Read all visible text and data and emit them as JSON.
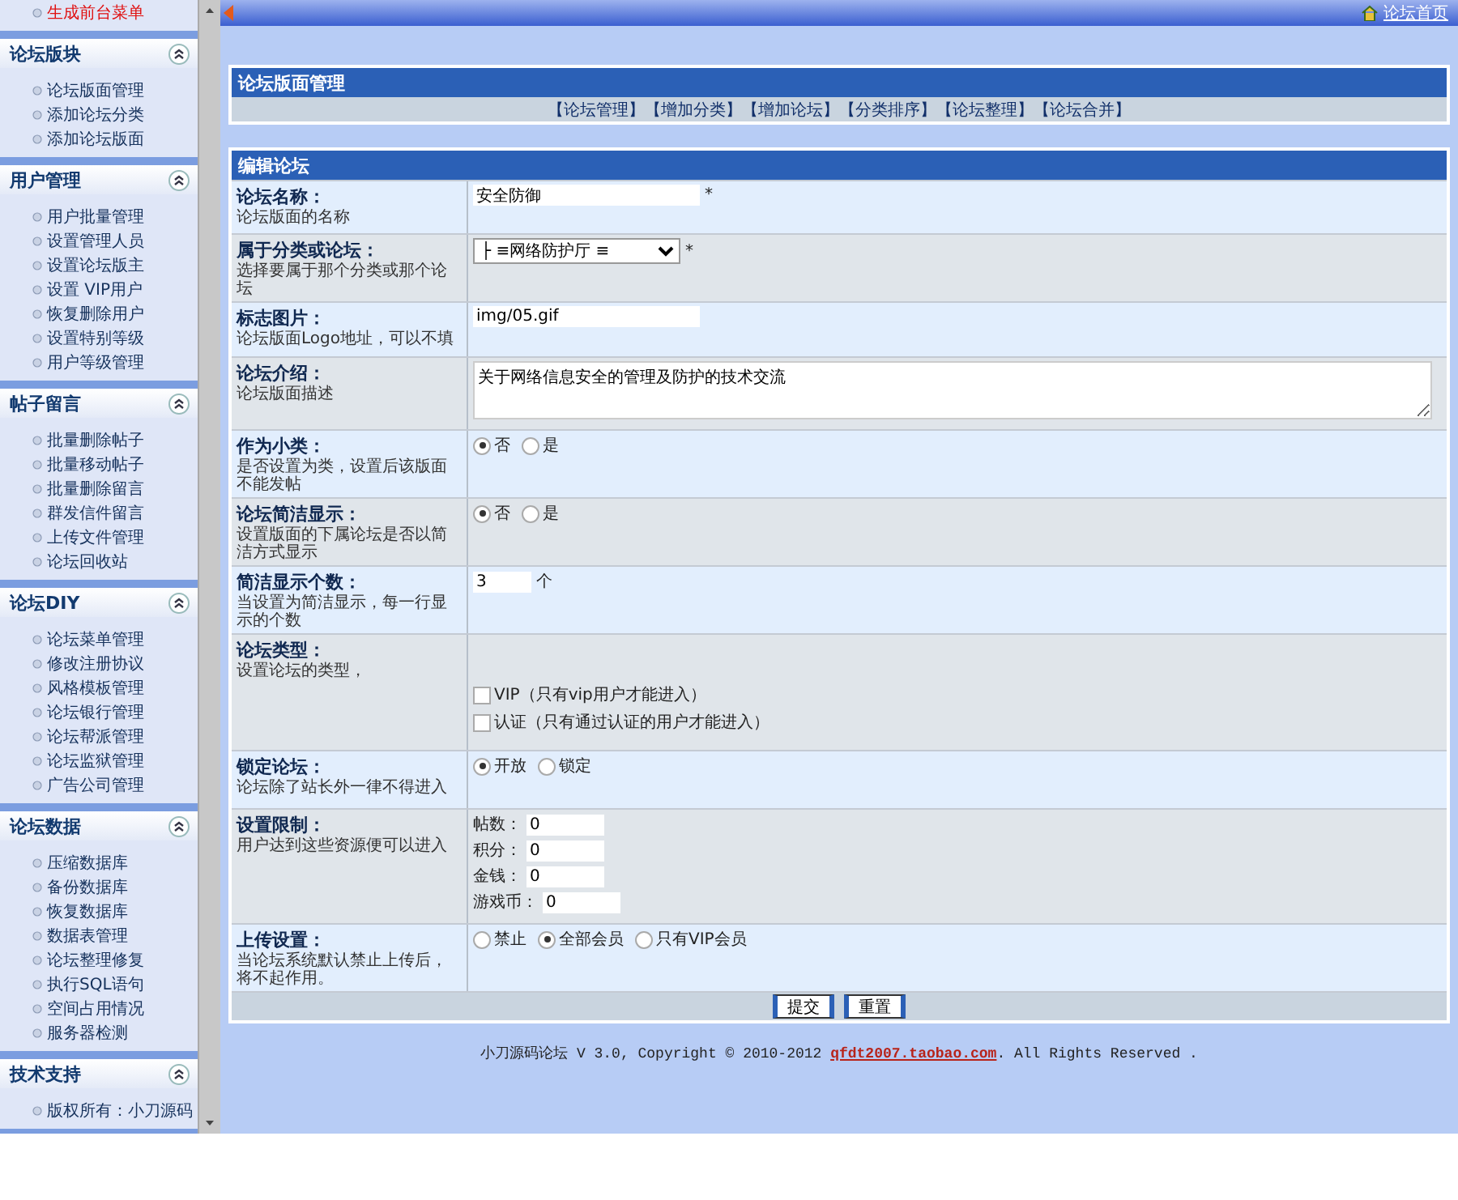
{
  "topbar": {
    "home_link": "论坛首页"
  },
  "sidebar": {
    "sections": [
      {
        "items": [
          {
            "label": "生成前台菜单",
            "highlighted": true
          }
        ]
      },
      {
        "title": "论坛版块",
        "items": [
          {
            "label": "论坛版面管理",
            "highlighted": false
          },
          {
            "label": "添加论坛分类",
            "highlighted": false
          },
          {
            "label": "添加论坛版面",
            "highlighted": false
          }
        ]
      },
      {
        "title": "用户管理",
        "items": [
          {
            "label": "用户批量管理",
            "highlighted": false
          },
          {
            "label": "设置管理人员",
            "highlighted": false
          },
          {
            "label": "设置论坛版主",
            "highlighted": false
          },
          {
            "label": "设置 VIP用户",
            "highlighted": false
          },
          {
            "label": "恢复删除用户",
            "highlighted": false
          },
          {
            "label": "设置特别等级",
            "highlighted": false
          },
          {
            "label": "用户等级管理",
            "highlighted": false
          }
        ]
      },
      {
        "title": "帖子留言",
        "items": [
          {
            "label": "批量删除帖子",
            "highlighted": false
          },
          {
            "label": "批量移动帖子",
            "highlighted": false
          },
          {
            "label": "批量删除留言",
            "highlighted": false
          },
          {
            "label": "群发信件留言",
            "highlighted": false
          },
          {
            "label": "上传文件管理",
            "highlighted": false
          },
          {
            "label": "论坛回收站",
            "highlighted": false
          }
        ]
      },
      {
        "title": "论坛DIY",
        "items": [
          {
            "label": "论坛菜单管理",
            "highlighted": false
          },
          {
            "label": "修改注册协议",
            "highlighted": false
          },
          {
            "label": "风格模板管理",
            "highlighted": false
          },
          {
            "label": "论坛银行管理",
            "highlighted": false
          },
          {
            "label": "论坛帮派管理",
            "highlighted": false
          },
          {
            "label": "论坛监狱管理",
            "highlighted": false
          },
          {
            "label": "广告公司管理",
            "highlighted": false
          }
        ]
      },
      {
        "title": "论坛数据",
        "items": [
          {
            "label": "压缩数据库",
            "highlighted": false
          },
          {
            "label": "备份数据库",
            "highlighted": false
          },
          {
            "label": "恢复数据库",
            "highlighted": false
          },
          {
            "label": "数据表管理",
            "highlighted": false
          },
          {
            "label": "论坛整理修复",
            "highlighted": false
          },
          {
            "label": "执行SQL语句",
            "highlighted": false
          },
          {
            "label": "空间占用情况",
            "highlighted": false
          },
          {
            "label": "服务器检测",
            "highlighted": false
          }
        ]
      },
      {
        "title": "技术支持",
        "items": [
          {
            "label": "版权所有：小刀源码",
            "highlighted": false
          }
        ]
      }
    ]
  },
  "manage_panel": {
    "title": "论坛版面管理",
    "links": [
      "【论坛管理】",
      "【增加分类】",
      "【增加论坛】",
      "【分类排序】",
      "【论坛整理】",
      "【论坛合并】"
    ]
  },
  "edit_form": {
    "title": "编辑论坛",
    "rows": [
      {
        "kind": "text",
        "label": "论坛名称：",
        "hint": "论坛版面的名称",
        "value": "安全防御",
        "suffix": "*"
      },
      {
        "kind": "select",
        "label": "属于分类或论坛：",
        "hint": "选择要属于那个分类或那个论坛",
        "value": "├ ≡网络防护厅 ≡",
        "suffix": "*"
      },
      {
        "kind": "text",
        "label": "标志图片：",
        "hint": "论坛版面Logo地址，可以不填",
        "value": "img/05.gif"
      },
      {
        "kind": "textarea",
        "label": "论坛介绍：",
        "hint": "论坛版面描述",
        "value": "关于网络信息安全的管理及防护的技术交流"
      },
      {
        "kind": "radio",
        "label": "作为小类：",
        "hint": "是否设置为类，设置后该版面不能发帖",
        "options": [
          {
            "label": "否",
            "selected": true
          },
          {
            "label": "是",
            "selected": false
          }
        ]
      },
      {
        "kind": "radio",
        "label": "论坛简洁显示：",
        "hint": "设置版面的下属论坛是否以简洁方式显示",
        "options": [
          {
            "label": "否",
            "selected": true
          },
          {
            "label": "是",
            "selected": false
          }
        ]
      },
      {
        "kind": "short",
        "label": "简洁显示个数：",
        "hint": "当设置为简洁显示，每一行显示的个数",
        "value": "3",
        "suffix": "个"
      },
      {
        "kind": "checkbox",
        "label": "论坛类型：",
        "hint": "设置论坛的类型，",
        "options": [
          {
            "label": "VIP（只有vip用户才能进入）",
            "checked": false
          },
          {
            "label": "认证（只有通过认证的用户才能进入）",
            "checked": false
          }
        ]
      },
      {
        "kind": "radio",
        "label": "锁定论坛：",
        "hint": "论坛除了站长外一律不得进入",
        "options": [
          {
            "label": "开放",
            "selected": true
          },
          {
            "label": "锁定",
            "selected": false
          }
        ]
      },
      {
        "kind": "limits",
        "label": "设置限制：",
        "hint": "用户达到这些资源便可以进入",
        "fields": [
          {
            "label": "帖数：",
            "value": "0"
          },
          {
            "label": "积分：",
            "value": "0"
          },
          {
            "label": "金钱：",
            "value": "0"
          },
          {
            "label": "游戏币：",
            "value": "0"
          }
        ]
      },
      {
        "kind": "radio",
        "label": "上传设置：",
        "hint": "当论坛系统默认禁止上传后，将不起作用。",
        "options": [
          {
            "label": "禁止",
            "selected": false
          },
          {
            "label": "全部会员",
            "selected": true
          },
          {
            "label": "只有VIP会员",
            "selected": false
          }
        ]
      }
    ],
    "buttons": [
      "提交",
      "重置"
    ]
  },
  "footer": {
    "before": "小刀源码论坛 V 3.0, Copyright © 2010-2012 ",
    "link": "qfdt2007.taobao.com",
    "after": ". All Rights Reserved ."
  }
}
